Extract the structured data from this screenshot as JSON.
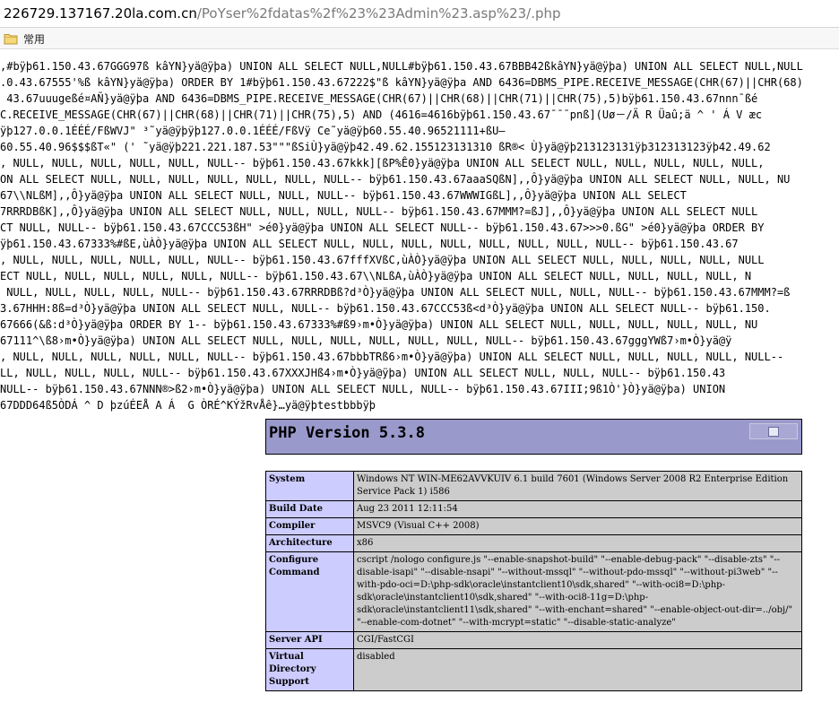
{
  "address_bar": {
    "host": "226729.137167.20la.com.cn",
    "path": "/PoYser%2fdatas%2f%23%23Admin%23.asp%23/.php"
  },
  "bookmarks": [
    {
      "label": "常用",
      "icon": "folder-icon"
    }
  ],
  "junk_lines": [
    ",#bÿþ61.150.43.67GGG97ß kâYN}yä@ÿþa) UNION ALL SELECT NULL,NULL#bÿþ61.150.43.67BBB42ßkâYN}yä@ÿþa) UNION ALL SELECT NULL,NULL",
    ".0.43.67555'%ß kâYN}yä@ÿþa) ORDER BY 1#bÿþ61.150.43.67222$\"ß kâYN}yä@ÿþa AND 6436=DBMS_PIPE.RECEIVE_MESSAGE(CHR(67)||CHR(68)",
    " 43.67uuugeßé¤AÑ}yä@ÿþa AND 6436=DBMS_PIPE.RECEIVE_MESSAGE(CHR(67)||CHR(68)||CHR(71)||CHR(75),5)bÿþ61.150.43.67nnn¯ßé",
    "C.RECEIVE_MESSAGE(CHR(67)||CHR(68)||CHR(71)||CHR(75),5) AND (4616=4616bÿþ61.150.43.67¯¯¯pnß](Uø－/Ä R Üaû;ä ^ ' Á V æc",
    "ÿþ127.0.0.1ÉÉÉ/FßWVJ\" ³˜yä@ÿþÿþ127.0.0.1ÉÉÉ/FßVÿ Ce˜yä@ÿþ60.55.40.96521111+ßU—",
    "60.55.40.96$$$ßT«\" (' ˜yä@ÿþ221.221.187.53\"\"\"ßSiÙ}yä@ÿþ42.49.62.155123131310 ßR®< Ù}yä@ÿþ213123131ÿþ312313123ÿþ42.49.62",
    ", NULL, NULL, NULL, NULL, NULL, NULL-- bÿþ61.150.43.67kkk][ßP%Ê0}yä@ÿþa UNION ALL SELECT NULL, NULL, NULL, NULL, NULL,",
    "ON ALL SELECT NULL, NULL, NULL, NULL, NULL, NULL, NULL-- bÿþ61.150.43.67aaaSQßN],,Ô}yä@ÿþa UNION ALL SELECT NULL, NULL, NU",
    "67\\\\NLßM],,Ô}yä@ÿþa UNION ALL SELECT NULL, NULL, NULL-- bÿþ61.150.43.67WWWIGßL],,Ô}yä@ÿþa UNION ALL SELECT",
    "7RRRDBßK],,Ô}yä@ÿþa UNION ALL SELECT NULL, NULL, NULL, NULL-- bÿþ61.150.43.67MMM?=ßJ],,Ô}yä@ÿþa UNION ALL SELECT NULL",
    "CT NULL, NULL-- bÿþ61.150.43.67CCC53ßH\" >é0}yä@ÿþa UNION ALL SELECT NULL-- bÿþ61.150.43.67>>>0.ßG\" >é0}yä@ÿþa ORDER BY",
    "ÿþ61.150.43.67333%#ßE,ùÀÒ}yä@ÿþa UNION ALL SELECT NULL, NULL, NULL, NULL, NULL, NULL, NULL, NULL-- bÿþ61.150.43.67",
    ", NULL, NULL, NULL, NULL, NULL, NULL-- bÿþ61.150.43.67fffXVßC,ùÀÒ}yä@ÿþa UNION ALL SELECT NULL, NULL, NULL, NULL, NULL",
    "ECT NULL, NULL, NULL, NULL, NULL, NULL-- bÿþ61.150.43.67\\\\NLßA,ùÀÒ}yä@ÿþa UNION ALL SELECT NULL, NULL, NULL, NULL, N",
    " NULL, NULL, NULL, NULL, NULL-- bÿþ61.150.43.67RRRDBß?d³Ò}yä@ÿþa UNION ALL SELECT NULL, NULL, NULL-- bÿþ61.150.43.67MMM?=ß",
    "3.67HHH:8ß=d³Ò}yä@ÿþa UNION ALL SELECT NULL, NULL-- bÿþ61.150.43.67CCC53ß<d³Ò}yä@ÿþa UNION ALL SELECT NULL-- bÿþ61.150.",
    "67666(&ß:d³Ò}yä@ÿþa ORDER BY 1-- bÿþ61.150.43.67333%#ß9›m•Ò}yä@ÿþa) UNION ALL SELECT NULL, NULL, NULL, NULL, NULL, NU",
    "67111^\\ß8›m•Ò}yä@ÿþa) UNION ALL SELECT NULL, NULL, NULL, NULL, NULL, NULL, NULL-- bÿþ61.150.43.67gggYWß7›m•Ò}yä@ÿ",
    ", NULL, NULL, NULL, NULL, NULL, NULL-- bÿþ61.150.43.67bbbTRß6›m•Ò}yä@ÿþa) UNION ALL SELECT NULL, NULL, NULL, NULL, NULL--",
    "LL, NULL, NULL, NULL, NULL-- bÿþ61.150.43.67XXXJHß4›m•Ò}yä@ÿþa) UNION ALL SELECT NULL, NULL, NULL-- bÿþ61.150.43",
    "NULL-- bÿþ61.150.43.67NNN®>ß2›m•Ò}yä@ÿþa) UNION ALL SELECT NULL, NULL-- bÿþ61.150.43.67III;9ß1Ò'}Ò}yä@ÿþa) UNION",
    "67DDD64ß5ÒDÁ ^ D þzúÉEÅ A Á  G ÒRÉ^KÝžRvÅê}…yä@ÿþtestbbbÿþ"
  ],
  "phpinfo": {
    "title": "PHP Version 5.3.8",
    "rows": [
      {
        "key": "System",
        "value": "Windows NT WIN-ME62AVVKUIV 6.1 build 7601 (Windows Server 2008 R2 Enterprise Edition Service Pack 1) i586"
      },
      {
        "key": "Build Date",
        "value": "Aug 23 2011 12:11:54"
      },
      {
        "key": "Compiler",
        "value": "MSVC9 (Visual C++ 2008)"
      },
      {
        "key": "Architecture",
        "value": "x86"
      },
      {
        "key": "Configure Command",
        "value": "cscript /nologo configure.js \"--enable-snapshot-build\" \"--enable-debug-pack\" \"--disable-zts\" \"--disable-isapi\" \"--disable-nsapi\" \"--without-mssql\" \"--without-pdo-mssql\" \"--without-pi3web\" \"--with-pdo-oci=D:\\php-sdk\\oracle\\instantclient10\\sdk,shared\" \"--with-oci8=D:\\php-sdk\\oracle\\instantclient10\\sdk,shared\" \"--with-oci8-11g=D:\\php-sdk\\oracle\\instantclient11\\sdk,shared\" \"--with-enchant=shared\" \"--enable-object-out-dir=../obj/\" \"--enable-com-dotnet\" \"--with-mcrypt=static\" \"--disable-static-analyze\""
      },
      {
        "key": "Server API",
        "value": "CGI/FastCGI"
      },
      {
        "key": "Virtual Directory Support",
        "value": "disabled"
      }
    ]
  }
}
